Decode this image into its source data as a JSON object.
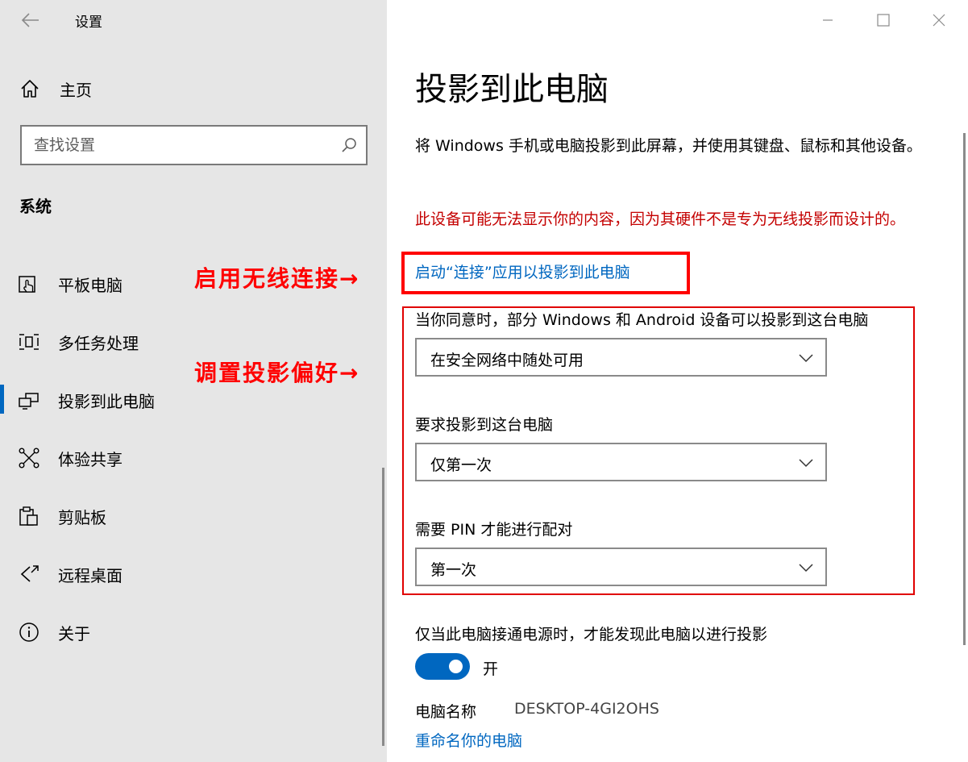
{
  "app": {
    "title": "设置"
  },
  "nav": {
    "home_label": "主页",
    "search_placeholder": "查找设置",
    "section_heading": "系统",
    "items": [
      {
        "label": "平板电脑",
        "icon": "tablet-icon"
      },
      {
        "label": "多任务处理",
        "icon": "multitasking-icon"
      },
      {
        "label": "投影到此电脑",
        "icon": "projecting-icon",
        "selected": true
      },
      {
        "label": "体验共享",
        "icon": "shared-experiences-icon"
      },
      {
        "label": "剪贴板",
        "icon": "clipboard-icon"
      },
      {
        "label": "远程桌面",
        "icon": "remote-desktop-icon"
      },
      {
        "label": "关于",
        "icon": "info-icon"
      }
    ]
  },
  "content": {
    "title": "投影到此电脑",
    "description": "将 Windows 手机或电脑投影到此屏幕，并使用其键盘、鼠标和其他设备。",
    "warning": "此设备可能无法显示你的内容，因为其硬件不是专为无线投影而设计的。",
    "connect_link": "启动“连接”应用以投影到此电脑",
    "settings": [
      {
        "label": "当你同意时，部分 Windows 和 Android 设备可以投影到这台电脑",
        "value": "在安全网络中随处可用"
      },
      {
        "label": "要求投影到这台电脑",
        "value": "仅第一次"
      },
      {
        "label": "需要 PIN 才能进行配对",
        "value": "第一次"
      }
    ],
    "power_toggle": {
      "label": "仅当此电脑接通电源时，才能发现此电脑以进行投影",
      "state": "开",
      "on": true
    },
    "pc_name_label": "电脑名称",
    "pc_name_value": "DESKTOP-4GI2OHS",
    "rename_link": "重命名你的电脑"
  },
  "annotations": {
    "enable_wireless": "启用无线连接→",
    "set_preferences": "调置投影偏好→"
  },
  "colors": {
    "accent": "#0067c0",
    "warning": "#c40000",
    "annotation": "#ff0000",
    "nav_background": "#e6e6e6"
  }
}
